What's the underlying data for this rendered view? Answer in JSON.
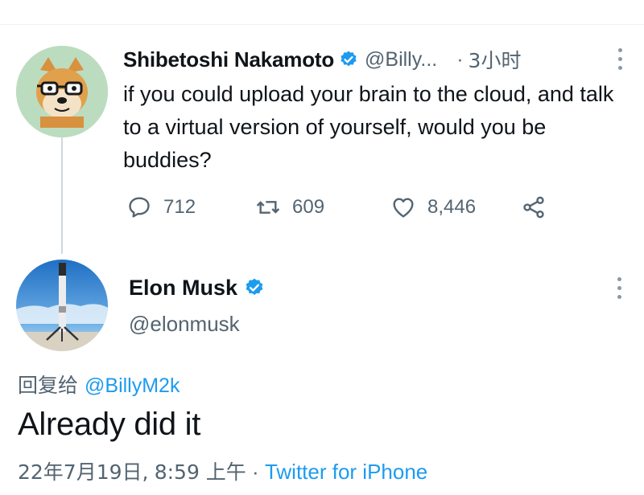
{
  "original_tweet": {
    "author_name": "Shibetoshi Nakamoto",
    "handle": "@Billy...",
    "separator": "·",
    "time_ago": "3小时",
    "text": "if you could upload your brain to the cloud, and talk to a virtual version of yourself, would you be buddies?",
    "replies": "712",
    "retweets": "609",
    "likes": "8,446"
  },
  "reply_tweet": {
    "author_name": "Elon Musk",
    "handle": "@elonmusk",
    "reply_prefix": "回复给",
    "reply_to_handle": "@BillyM2k",
    "text": "Already did it",
    "date": "22年7月19日,",
    "time": "8:59 上午",
    "separator": "·",
    "source": "Twitter for iPhone"
  },
  "colors": {
    "verified": "#1d9bf0",
    "link": "#1d9bf0",
    "secondary_text": "#536471"
  },
  "icons": [
    "verified-badge-icon",
    "more-options-icon",
    "reply-icon",
    "retweet-icon",
    "like-icon",
    "share-icon"
  ]
}
